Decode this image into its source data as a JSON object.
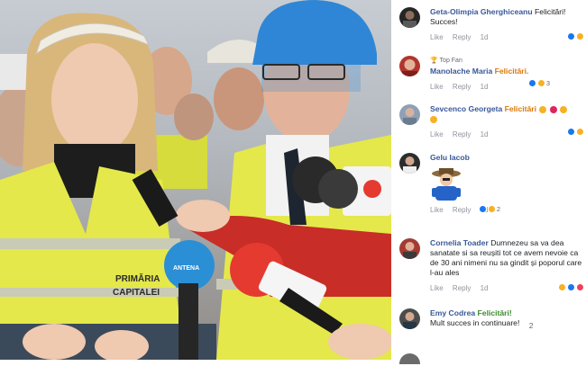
{
  "photo": {
    "left_vest_text": [
      "PRIMĂRIA",
      "CAPITALEI"
    ],
    "mic_brand": "ANTENA"
  },
  "actions": {
    "like": "Like",
    "reply": "Reply"
  },
  "comments": [
    {
      "name": "Geta-Olimpia Gherghiceanu",
      "text_main": "Felicitări!",
      "text_second": "Succes!",
      "time": "1d",
      "reaction_count": ""
    },
    {
      "badge": "Top Fan",
      "name": "Manolache Maria",
      "text_main": "Felicitări.",
      "time": "1d",
      "reaction_count": "3"
    },
    {
      "name": "Sevcenco Georgeta",
      "text_main": "Felicitări",
      "time": "1d",
      "reaction_count": ""
    },
    {
      "name": "Gelu Iacob",
      "time": "1d",
      "reaction_count": "2"
    },
    {
      "name": "Cornelia Toader",
      "text_main": "Dumnezeu sa va dea sanatate si sa reușiti tot ce avem nevoie ca de 30 ani nimeni nu sa gindit și poporul care l-au ales",
      "time": "1d",
      "reaction_count": ""
    },
    {
      "name": "Emy Codrea",
      "text_main": "Felicitări!",
      "text_second": "Mult succes in continuare!",
      "time": "1d",
      "reaction_count": "2"
    }
  ],
  "colors": {
    "name_blue": "#385898",
    "vest_yellow": "#e4e84a",
    "hardhat_blue": "#2f86d6",
    "mic_red": "#e53a30"
  }
}
